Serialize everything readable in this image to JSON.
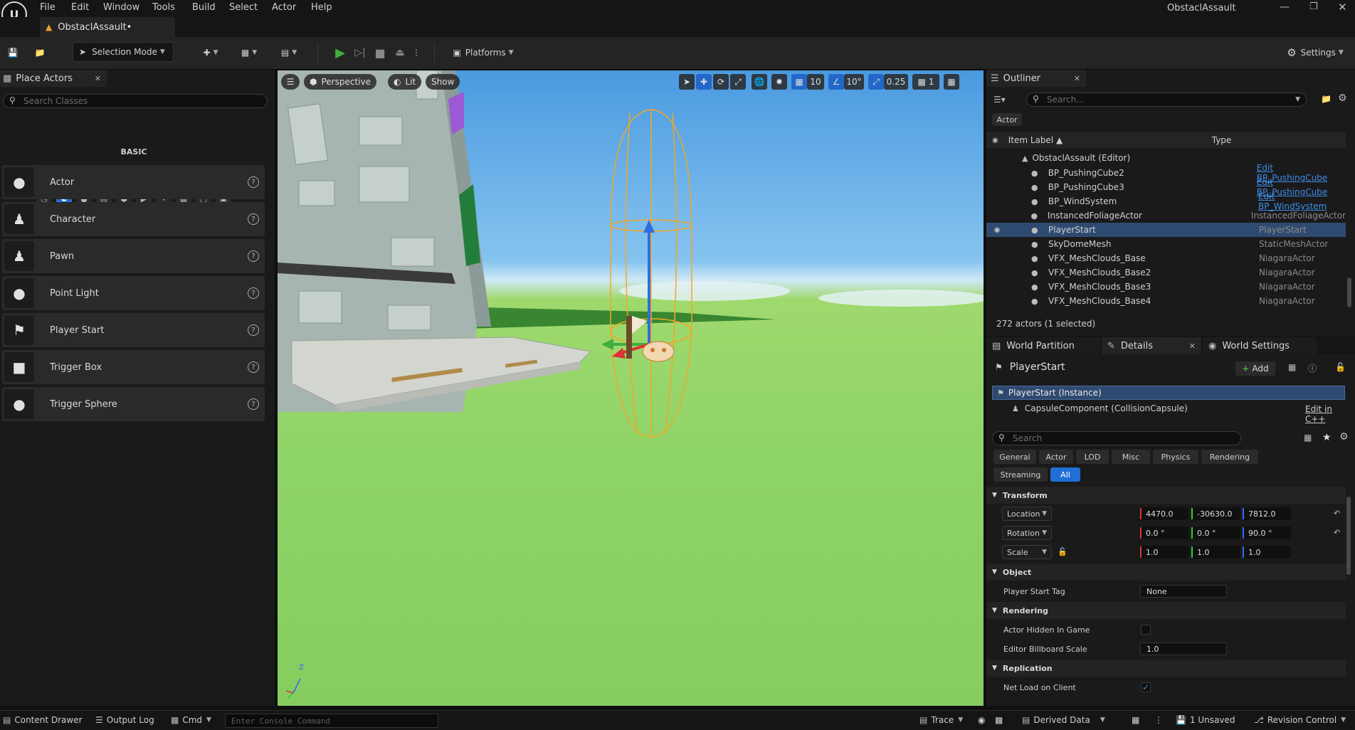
{
  "app": {
    "project_name": "ObstaclAssault",
    "level_tab": "ObstaclAssault•"
  },
  "menu": [
    "File",
    "Edit",
    "Window",
    "Tools",
    "Build",
    "Select",
    "Actor",
    "Help"
  ],
  "toolbar": {
    "selection_mode": "Selection Mode",
    "platforms": "Platforms",
    "settings": "Settings"
  },
  "place_actors": {
    "tab_title": "Place Actors",
    "search_placeholder": "Search Classes",
    "category_label": "BASIC",
    "items": [
      {
        "label": "Actor",
        "icon": "sphere-icon"
      },
      {
        "label": "Character",
        "icon": "character-icon"
      },
      {
        "label": "Pawn",
        "icon": "pawn-icon"
      },
      {
        "label": "Point Light",
        "icon": "point-light-icon"
      },
      {
        "label": "Player Start",
        "icon": "player-start-icon"
      },
      {
        "label": "Trigger Box",
        "icon": "trigger-box-icon"
      },
      {
        "label": "Trigger Sphere",
        "icon": "trigger-sphere-icon"
      }
    ]
  },
  "viewport": {
    "perspective": "Perspective",
    "lit": "Lit",
    "show": "Show",
    "grid_snap": "10",
    "rotation_snap": "10°",
    "scale_snap": "0.25",
    "camera_speed": "1",
    "axis_z": "Z"
  },
  "outliner": {
    "tab_title": "Outliner",
    "search_placeholder": "Search...",
    "filter_chip": "Actor",
    "col_label": "Item Label ▲",
    "col_type": "Type",
    "root": "ObstaclAssault (Editor)",
    "rows": [
      {
        "name": "BP_PushingCube2",
        "type": "Edit BP_PushingCube",
        "link": true,
        "selected": false
      },
      {
        "name": "BP_PushingCube3",
        "type": "Edit BP_PushingCube",
        "link": true,
        "selected": false
      },
      {
        "name": "BP_WindSystem",
        "type": "Edit BP_WindSystem",
        "link": true,
        "selected": false
      },
      {
        "name": "InstancedFoliageActor",
        "type": "InstancedFoliageActor",
        "link": false,
        "selected": false
      },
      {
        "name": "PlayerStart",
        "type": "PlayerStart",
        "link": false,
        "selected": true
      },
      {
        "name": "SkyDomeMesh",
        "type": "StaticMeshActor",
        "link": false,
        "selected": false
      },
      {
        "name": "VFX_MeshClouds_Base",
        "type": "NiagaraActor",
        "link": false,
        "selected": false
      },
      {
        "name": "VFX_MeshClouds_Base2",
        "type": "NiagaraActor",
        "link": false,
        "selected": false
      },
      {
        "name": "VFX_MeshClouds_Base3",
        "type": "NiagaraActor",
        "link": false,
        "selected": false
      },
      {
        "name": "VFX_MeshClouds_Base4",
        "type": "NiagaraActor",
        "link": false,
        "selected": false
      }
    ],
    "count_text": "272 actors (1 selected)"
  },
  "details": {
    "tabs": [
      "World Partition",
      "Details",
      "World Settings"
    ],
    "actor_name": "PlayerStart",
    "add_label": "Add",
    "instance_label": "PlayerStart (Instance)",
    "component_label": "CapsuleComponent (CollisionCapsule)",
    "edit_cpp": "Edit in C++",
    "search_placeholder": "Search",
    "filters": [
      "General",
      "Actor",
      "LOD",
      "Misc",
      "Physics",
      "Rendering",
      "Streaming",
      "All"
    ],
    "active_filter": "All",
    "sections": {
      "transform": "Transform",
      "object": "Object",
      "rendering": "Rendering",
      "replication": "Replication"
    },
    "location": {
      "label": "Location",
      "x": "4470.0",
      "y": "-30630.0",
      "z": "7812.0"
    },
    "rotation": {
      "label": "Rotation",
      "x": "0.0 °",
      "y": "0.0 °",
      "z": "90.0 °"
    },
    "scale": {
      "label": "Scale",
      "x": "1.0",
      "y": "1.0",
      "z": "1.0"
    },
    "player_start_tag": {
      "label": "Player Start Tag",
      "value": "None"
    },
    "actor_hidden": {
      "label": "Actor Hidden In Game"
    },
    "billboard_scale": {
      "label": "Editor Billboard Scale",
      "value": "1.0"
    },
    "net_load": {
      "label": "Net Load on Client"
    }
  },
  "statusbar": {
    "content_drawer": "Content Drawer",
    "output_log": "Output Log",
    "cmd": "Cmd",
    "console_placeholder": "Enter Console Command",
    "trace": "Trace",
    "derived_data": "Derived Data",
    "unsaved": "1 Unsaved",
    "revision_control": "Revision Control"
  },
  "colors": {
    "accent": "#1f6fd6",
    "selection_row": "#2f4a70",
    "play_green": "#3fae3f",
    "axis_x": "#d33",
    "axis_y": "#3c3",
    "axis_z": "#36f",
    "capsule": "#f5a623"
  }
}
